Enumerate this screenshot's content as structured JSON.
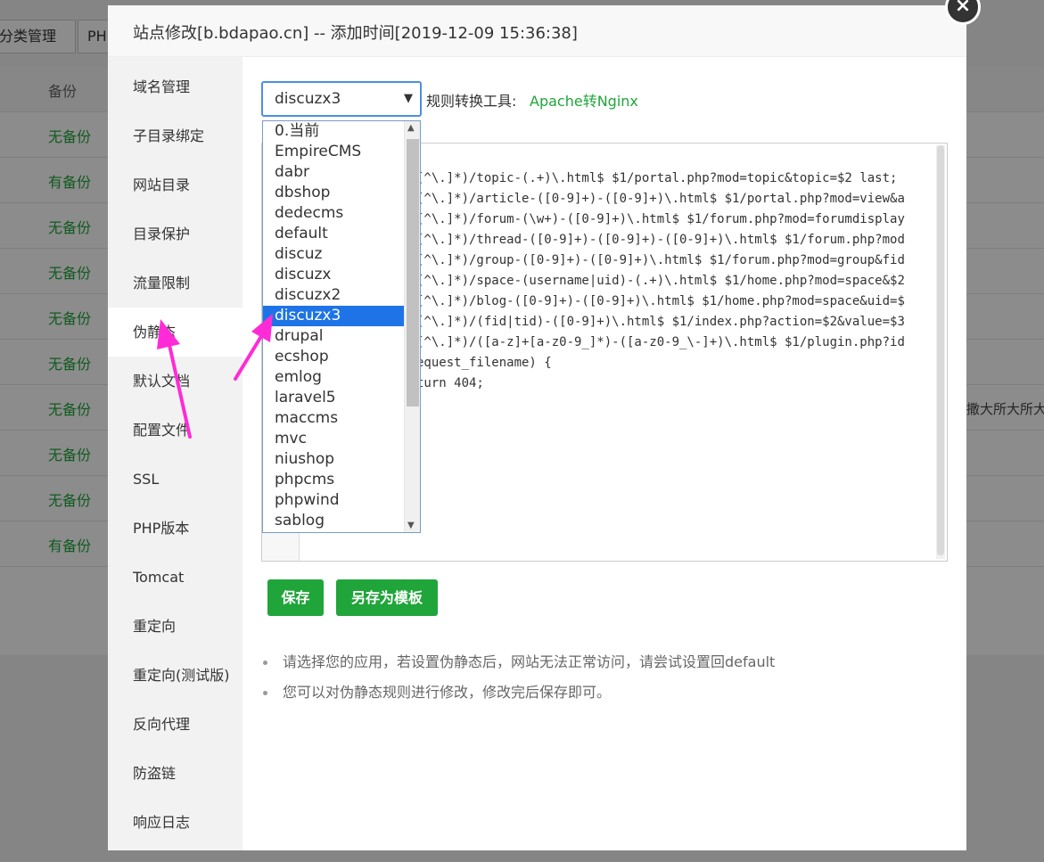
{
  "background": {
    "toolbar_buttons": [
      "分类管理",
      "PH"
    ],
    "column_header": "备份",
    "rows": [
      "无备份",
      "有备份",
      "无备份",
      "无备份",
      "无备份",
      "无备份",
      "无备份",
      "无备份",
      "无备份",
      "有备份"
    ],
    "right_text": "撒大所大所大"
  },
  "modal": {
    "title": "站点修改[b.bdapao.cn] -- 添加时间[2019-12-09 15:36:38]",
    "close_glyph": "×"
  },
  "sidebar": {
    "items": [
      "域名管理",
      "子目录绑定",
      "网站目录",
      "目录保护",
      "流量限制",
      "伪静态",
      "默认文档",
      "配置文件",
      "SSL",
      "PHP版本",
      "Tomcat",
      "重定向",
      "重定向(测试版)",
      "反向代理",
      "防盗链",
      "响应日志"
    ],
    "active": "伪静态"
  },
  "rewrite": {
    "selected_value": "discuzx3",
    "tool_label": "规则转换工具:",
    "tool_link": "Apache转Nginx",
    "options": [
      "0.当前",
      "EmpireCMS",
      "dabr",
      "dbshop",
      "dedecms",
      "default",
      "discuz",
      "discuzx",
      "discuzx2",
      "discuzx3",
      "drupal",
      "ecshop",
      "emlog",
      "laravel5",
      "maccms",
      "mvc",
      "niushop",
      "phpcms",
      "phpwind",
      "sablog"
    ],
    "code_lines": [
      "[^\\.]*)/topic-(.+)\\.html$ $1/portal.php?mod=topic&topic=$2 last;",
      "[^\\.]*)/article-([0-9]+)-([0-9]+)\\.html$ $1/portal.php?mod=view&a",
      "[^\\.]*)/forum-(\\w+)-([0-9]+)\\.html$ $1/forum.php?mod=forumdisplay",
      "[^\\.]*)/thread-([0-9]+)-([0-9]+)-([0-9]+)\\.html$ $1/forum.php?mod",
      "[^\\.]*)/group-([0-9]+)-([0-9]+)\\.html$ $1/forum.php?mod=group&fid",
      "[^\\.]*)/space-(username|uid)-(.+)\\.html$ $1/home.php?mod=space&$2",
      "[^\\.]*)/blog-([0-9]+)-([0-9]+)\\.html$ $1/home.php?mod=space&uid=$",
      "[^\\.]*)/(fid|tid)-([0-9]+)\\.html$ $1/index.php?action=$2&value=$3",
      "[^\\.]*)/([a-z]+[a-z0-9_]*)-([a-z0-9_\\-]+)\\.html$ $1/plugin.php?id",
      "equest_filename) {",
      "turn 404;"
    ],
    "save_label": "保存",
    "save_template_label": "另存为模板",
    "tips": [
      "请选择您的应用，若设置伪静态后，网站无法正常访问，请尝试设置回default",
      "您可以对伪静态规则进行修改，修改完后保存即可。"
    ]
  },
  "colors": {
    "accent_green": "#20a53a",
    "selection_blue": "#1e74e6",
    "annotation_magenta": "#ff2bd6"
  }
}
